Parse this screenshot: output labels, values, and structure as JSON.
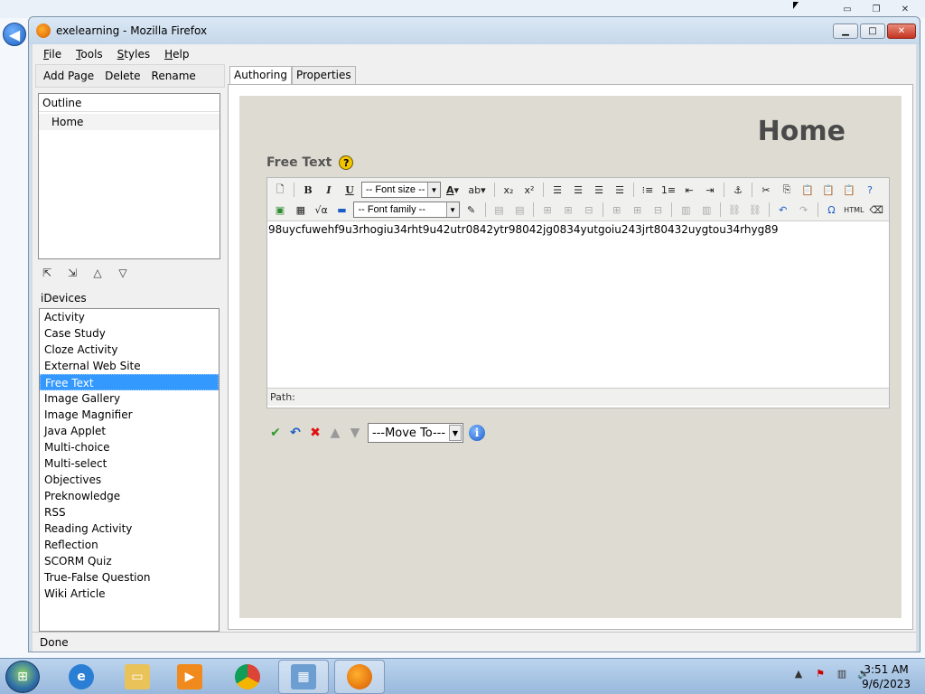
{
  "window": {
    "title": "exelearning - Mozilla Firefox"
  },
  "menu": {
    "items": [
      "File",
      "Tools",
      "Styles",
      "Help"
    ]
  },
  "left_toolbar": {
    "add_page": "Add Page",
    "delete": "Delete",
    "rename": "Rename"
  },
  "outline": {
    "header": "Outline",
    "items": [
      "Home"
    ]
  },
  "idevices": {
    "label": "iDevices",
    "items": [
      "Activity",
      "Case Study",
      "Cloze Activity",
      "External Web Site",
      "Free Text",
      "Image Gallery",
      "Image Magnifier",
      "Java Applet",
      "Multi-choice",
      "Multi-select",
      "Objectives",
      "Preknowledge",
      "RSS",
      "Reading Activity",
      "Reflection",
      "SCORM Quiz",
      "True-False Question",
      "Wiki Article"
    ],
    "selected": "Free Text"
  },
  "tabs": [
    "Authoring",
    "Properties"
  ],
  "content": {
    "page_title": "Home",
    "idevice_title": "Free Text",
    "editor_text": "98uycfuwehf9u3rhogiu34rht9u42utr0842ytr98042jg0834yutgoiu243jrt80432uygtou34rhyg89",
    "font_size_placeholder": "-- Font size --",
    "font_family_placeholder": "-- Font family --",
    "path_label": "Path:",
    "move_to": "---Move To---"
  },
  "status": {
    "text": "Done"
  },
  "clock": {
    "time": "3:51 AM",
    "date": "9/6/2023"
  },
  "colors": {
    "selection": "#3399ff",
    "canvas": "#dedcd2",
    "heading": "#4a4a4a"
  }
}
